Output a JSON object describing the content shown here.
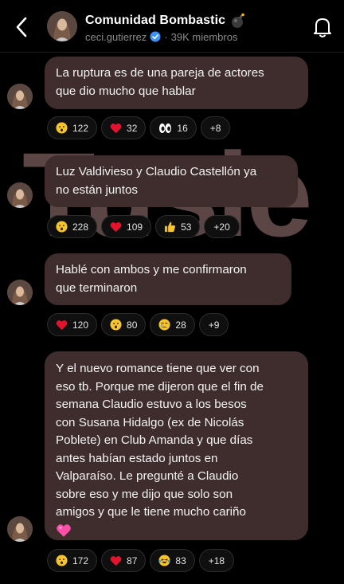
{
  "header": {
    "title": "Comunidad Bombastic",
    "title_emoji": "bomb",
    "owner": "ceci.gutierrez",
    "separator": "·",
    "members": "39K miembros",
    "verified_color": "#3d93f5"
  },
  "watermark": {
    "text": "Tusie"
  },
  "colors": {
    "bubble": "#3f2d2d",
    "background": "#000000",
    "accent_heart": "#e5122e",
    "pink_heart": "#ff4fa8"
  },
  "messages": [
    {
      "text_lines": [
        "La ruptura es de una pareja de actores",
        "que dio mucho que hablar"
      ],
      "reactions": [
        {
          "emoji": "hushed-face",
          "count": "122"
        },
        {
          "emoji": "red-heart",
          "count": "32"
        },
        {
          "emoji": "eyes",
          "count": "16"
        }
      ],
      "more": "+8"
    },
    {
      "text_lines": [
        "Luz Valdivieso y Claudio Castellón ya",
        "no están juntos"
      ],
      "reactions": [
        {
          "emoji": "hushed-face",
          "count": "228"
        },
        {
          "emoji": "red-heart",
          "count": "109"
        },
        {
          "emoji": "thumbs-up",
          "count": "53"
        }
      ],
      "more": "+20"
    },
    {
      "text_lines": [
        "Hablé con ambos y me confirmaron",
        "que terminaron"
      ],
      "reactions": [
        {
          "emoji": "red-heart",
          "count": "120"
        },
        {
          "emoji": "hushed-face",
          "count": "80"
        },
        {
          "emoji": "crying-face",
          "count": "28"
        }
      ],
      "more": "+9"
    },
    {
      "text_lines": [
        "Y el nuevo romance tiene que ver con",
        "eso tb. Porque me dijeron que el fin de",
        "semana Claudio estuvo a los besos",
        "con Susana Hidalgo (ex de Nicolás",
        "Poblete) en Club Amanda y que días",
        "antes habían estado juntos en",
        "Valparaíso. Le pregunté a Claudio",
        "sobre eso y me dijo que solo son",
        "amigos y que le tiene mucho cariño"
      ],
      "trailing_emoji": "pink-heart",
      "reactions": [
        {
          "emoji": "hushed-face",
          "count": "172"
        },
        {
          "emoji": "red-heart",
          "count": "87"
        },
        {
          "emoji": "laughing-tears",
          "count": "83"
        }
      ],
      "more": "+18"
    }
  ]
}
